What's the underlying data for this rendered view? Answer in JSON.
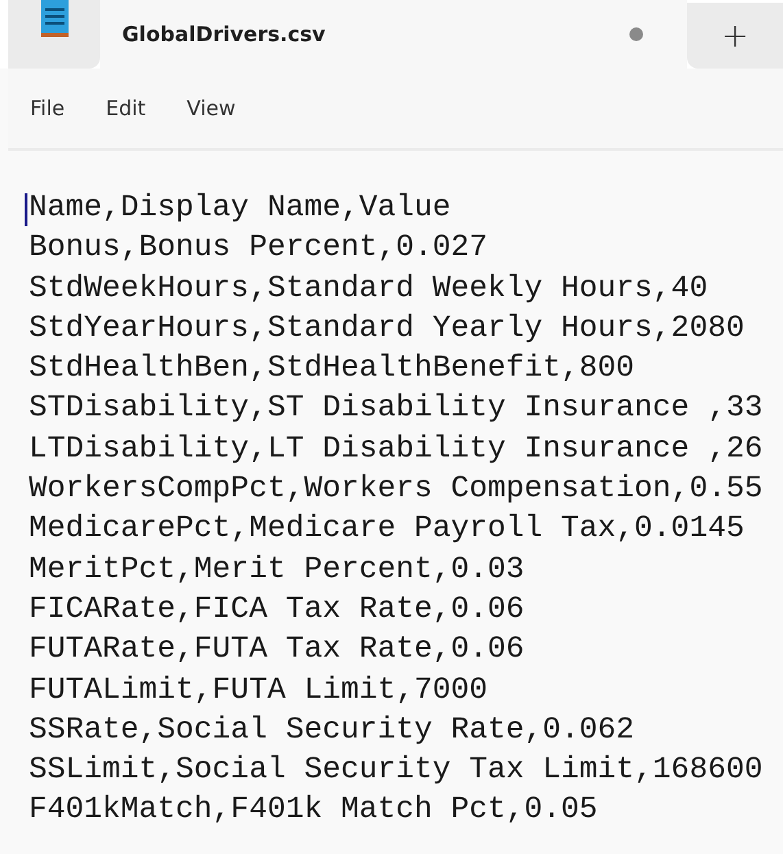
{
  "tab": {
    "title": "GlobalDrivers.csv",
    "modified": true,
    "selected": true
  },
  "new_tab_button": "+",
  "menu": [
    "File",
    "Edit",
    "View"
  ],
  "editor": {
    "lines": [
      "Name,Display Name,Value",
      "Bonus,Bonus Percent,0.027",
      "StdWeekHours,Standard Weekly Hours,40",
      "StdYearHours,Standard Yearly Hours,2080",
      "StdHealthBen,StdHealthBenefit,800",
      "STDisability,ST Disability Insurance ,33",
      "LTDisability,LT Disability Insurance ,26",
      "WorkersCompPct,Workers Compensation,0.55",
      "MedicarePct,Medicare Payroll Tax,0.0145",
      "MeritPct,Merit Percent,0.03",
      "FICARate,FICA Tax Rate,0.06",
      "FUTARate,FUTA Tax Rate,0.06",
      "FUTALimit,FUTA Limit,7000",
      "SSRate,Social Security Rate,0.062",
      "SSLimit,Social Security Tax Limit,168600",
      "F401kMatch,F401k Match Pct,0.05"
    ]
  }
}
